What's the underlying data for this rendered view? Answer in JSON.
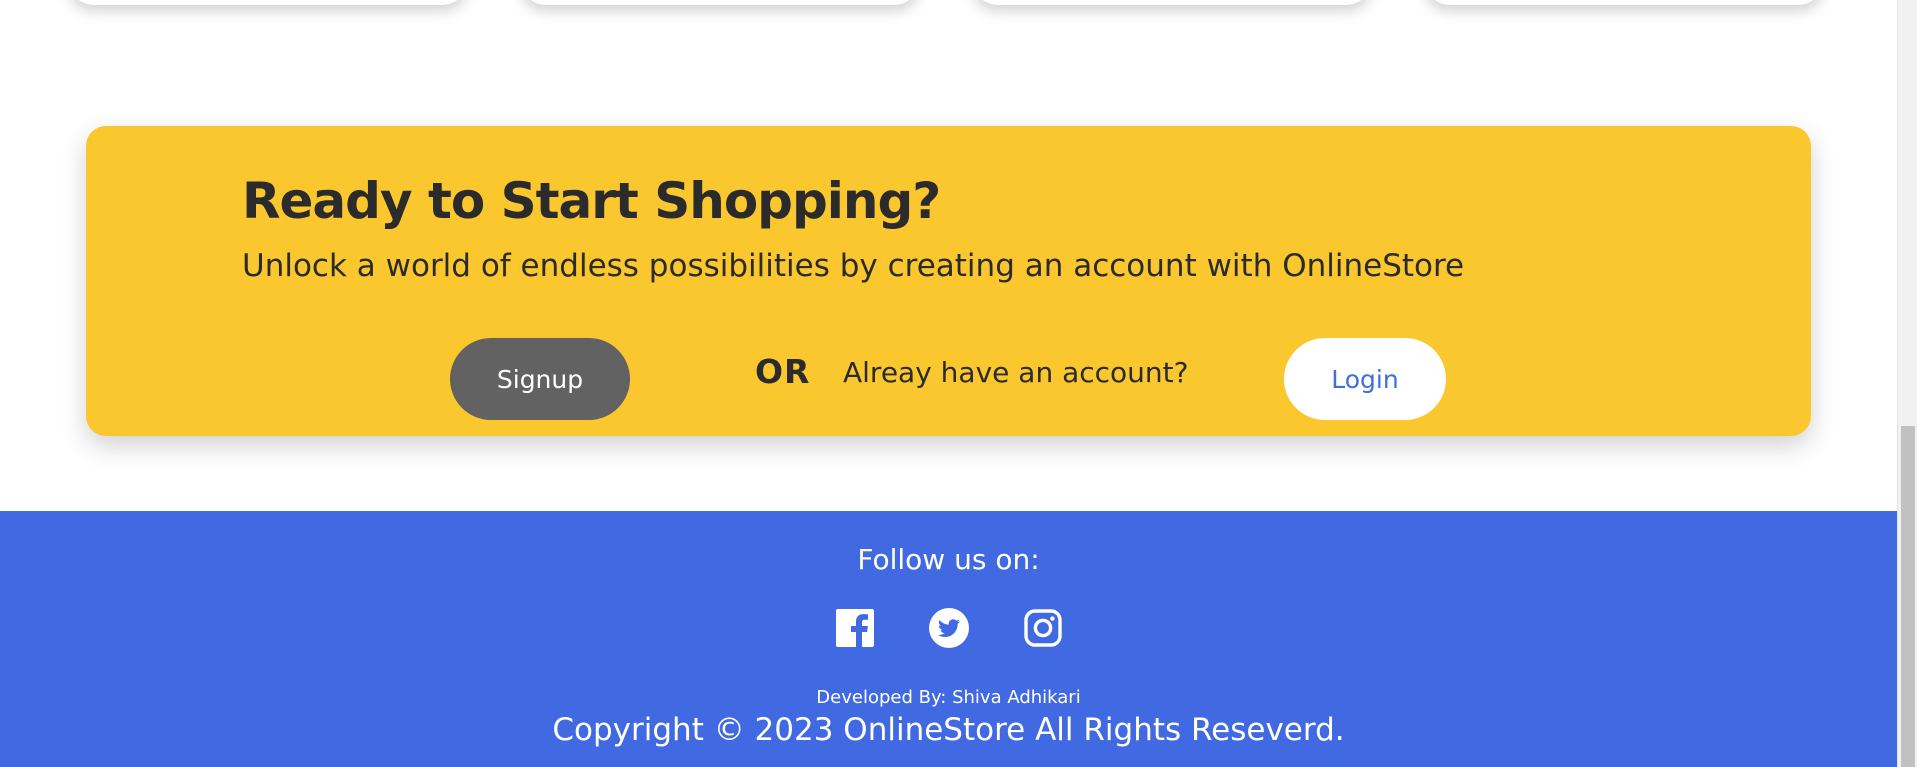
{
  "cta": {
    "title": "Ready to Start Shopping?",
    "subtitle": "Unlock a world of endless possibilities by creating an account with OnlineStore",
    "signup_label": "Signup",
    "or_label": "OR",
    "have_account_text": "Alreay have an account?",
    "login_label": "Login"
  },
  "footer": {
    "follow_label": "Follow us on:",
    "socials": [
      {
        "name": "facebook-icon"
      },
      {
        "name": "twitter-icon"
      },
      {
        "name": "instagram-icon"
      }
    ],
    "developed_by": "Developed By: Shiva Adhikari",
    "copyright": "Copyright © 2023 OnlineStore All Rights Reseverd."
  },
  "colors": {
    "banner": "#fbc72f",
    "footer": "#4169e1",
    "signup_button": "#626262",
    "login_text": "#3f6fd8",
    "text_dark": "#2b2b2b"
  }
}
